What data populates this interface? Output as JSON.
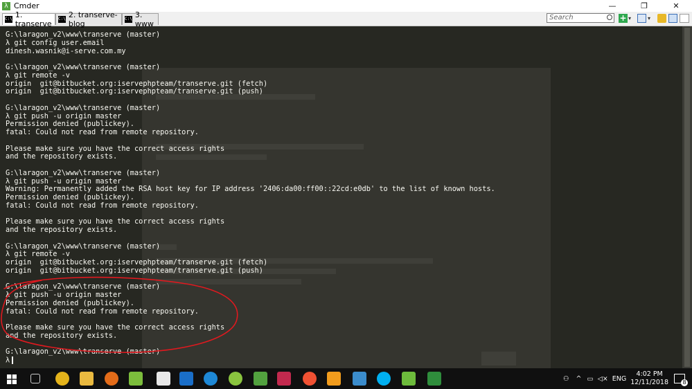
{
  "window": {
    "title": "Cmder"
  },
  "tabs": [
    {
      "label": "1. transerve",
      "active": true
    },
    {
      "label": "2. transerve-blog",
      "active": false
    },
    {
      "label": "3. www",
      "active": false
    }
  ],
  "search": {
    "placeholder": "Search"
  },
  "terminal": {
    "lines": [
      {
        "type": "prompt",
        "path": "G:\\laragon_v2\\www\\transerve",
        "branch": " (master)"
      },
      {
        "type": "cmd",
        "text": "λ git config user.email"
      },
      {
        "type": "out",
        "text": "dinesh.wasnik@i-serve.com.my"
      },
      {
        "type": "blank",
        "text": ""
      },
      {
        "type": "prompt",
        "path": "G:\\laragon_v2\\www\\transerve",
        "branch": " (master)"
      },
      {
        "type": "cmd",
        "text": "λ git remote -v"
      },
      {
        "type": "out",
        "text": "origin  git@bitbucket.org:iservephpteam/transerve.git (fetch)"
      },
      {
        "type": "out",
        "text": "origin  git@bitbucket.org:iservephpteam/transerve.git (push)"
      },
      {
        "type": "blank",
        "text": ""
      },
      {
        "type": "prompt",
        "path": "G:\\laragon_v2\\www\\transerve",
        "branch": " (master)"
      },
      {
        "type": "cmd",
        "text": "λ git push -u origin master"
      },
      {
        "type": "out",
        "text": "Permission denied (publickey)."
      },
      {
        "type": "out",
        "text": "fatal: Could not read from remote repository."
      },
      {
        "type": "blank",
        "text": ""
      },
      {
        "type": "out",
        "text": "Please make sure you have the correct access rights"
      },
      {
        "type": "out",
        "text": "and the repository exists."
      },
      {
        "type": "blank",
        "text": ""
      },
      {
        "type": "prompt",
        "path": "G:\\laragon_v2\\www\\transerve",
        "branch": " (master)"
      },
      {
        "type": "cmd",
        "text": "λ git push -u origin master"
      },
      {
        "type": "out",
        "text": "Warning: Permanently added the RSA host key for IP address '2406:da00:ff00::22cd:e0db' to the list of known hosts."
      },
      {
        "type": "out",
        "text": "Permission denied (publickey)."
      },
      {
        "type": "out",
        "text": "fatal: Could not read from remote repository."
      },
      {
        "type": "blank",
        "text": ""
      },
      {
        "type": "out",
        "text": "Please make sure you have the correct access rights"
      },
      {
        "type": "out",
        "text": "and the repository exists."
      },
      {
        "type": "blank",
        "text": ""
      },
      {
        "type": "prompt",
        "path": "G:\\laragon_v2\\www\\transerve",
        "branch": " (master)"
      },
      {
        "type": "cmd",
        "text": "λ git remote -v"
      },
      {
        "type": "out",
        "text": "origin  git@bitbucket.org:iservephpteam/transerve.git (fetch)"
      },
      {
        "type": "out",
        "text": "origin  git@bitbucket.org:iservephpteam/transerve.git (push)"
      },
      {
        "type": "blank",
        "text": ""
      },
      {
        "type": "prompt",
        "path": "G:\\laragon_v2\\www\\transerve",
        "branch": " (master)"
      },
      {
        "type": "cmd",
        "text": "λ git push -u origin master"
      },
      {
        "type": "out",
        "text": "Permission denied (publickey)."
      },
      {
        "type": "out",
        "text": "fatal: Could not read from remote repository."
      },
      {
        "type": "blank",
        "text": ""
      },
      {
        "type": "out",
        "text": "Please make sure you have the correct access rights"
      },
      {
        "type": "out",
        "text": "and the repository exists."
      },
      {
        "type": "blank",
        "text": ""
      },
      {
        "type": "prompt",
        "path": "G:\\laragon_v2\\www\\transerve",
        "branch": " (master)"
      },
      {
        "type": "cmd",
        "text": "λ"
      }
    ]
  },
  "colors": {
    "terminal_bg": "#272822",
    "terminal_fg": "#f8f8f2",
    "annotation": "#e0191f",
    "taskbar_bg": "#101010"
  },
  "taskbar": {
    "apps": [
      {
        "icon": "chrome-icon",
        "color": "#e4b31b"
      },
      {
        "icon": "file-explorer-icon",
        "color": "#e9b940"
      },
      {
        "icon": "firefox-icon",
        "color": "#e36b19"
      },
      {
        "icon": "notepad-plus-plus-icon",
        "color": "#7cbd3c"
      },
      {
        "icon": "document-icon",
        "color": "#e8e8e8"
      },
      {
        "icon": "outlook-icon",
        "color": "#1a6ec8"
      },
      {
        "icon": "edge-icon",
        "color": "#1e88d6"
      },
      {
        "icon": "hs-app-icon",
        "color": "#8ac43f"
      },
      {
        "icon": "cmder-icon",
        "color": "#52a13f"
      },
      {
        "icon": "flag-app-icon",
        "color": "#c2294e"
      },
      {
        "icon": "git-gui-icon",
        "color": "#f05133"
      },
      {
        "icon": "sublime-text-icon",
        "color": "#f29c1d"
      },
      {
        "icon": "network-app-icon",
        "color": "#3b8ccc"
      },
      {
        "icon": "skype-icon",
        "color": "#00aff0"
      },
      {
        "icon": "notepad-green-icon",
        "color": "#6dbb3c"
      },
      {
        "icon": "project-app-icon",
        "color": "#2f8d3c"
      }
    ],
    "tray": {
      "language": "ENG",
      "time": "4:02 PM",
      "date": "12/11/2018",
      "notification_count": "8"
    }
  }
}
